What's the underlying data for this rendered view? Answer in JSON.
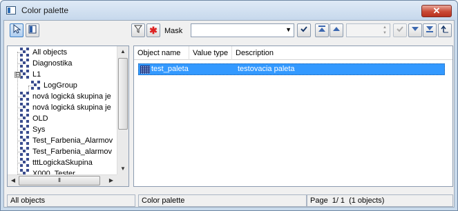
{
  "window": {
    "title": "Color palette",
    "close_label": "✕"
  },
  "toolbar": {
    "mask_label": "Mask",
    "mask_value": "",
    "spin_value": ""
  },
  "tree": {
    "items": [
      {
        "label": "All objects",
        "level": 0,
        "expander": ""
      },
      {
        "label": "Diagnostika",
        "level": 0,
        "expander": ""
      },
      {
        "label": "L1",
        "level": 0,
        "expander": "⊟"
      },
      {
        "label": "LogGroup",
        "level": 1,
        "expander": ""
      },
      {
        "label": "nová logická skupina je",
        "level": 0,
        "expander": ""
      },
      {
        "label": "nová logická skupina je",
        "level": 0,
        "expander": ""
      },
      {
        "label": "OLD",
        "level": 0,
        "expander": ""
      },
      {
        "label": "Sys",
        "level": 0,
        "expander": ""
      },
      {
        "label": "Test_Farbenia_Alarmov",
        "level": 0,
        "expander": ""
      },
      {
        "label": "Test_Farbenia_alarmov",
        "level": 0,
        "expander": ""
      },
      {
        "label": "tttLogickaSkupina",
        "level": 0,
        "expander": ""
      },
      {
        "label": "X000_Tester",
        "level": 0,
        "expander": ""
      }
    ]
  },
  "list": {
    "columns": [
      "Object name",
      "Value type",
      "Description"
    ],
    "rows": [
      {
        "name": "test_paleta",
        "value_type": "",
        "description": "testovacia paleta"
      }
    ]
  },
  "status": {
    "scope": "All objects",
    "object_type": "Color palette",
    "page_label": "Page",
    "page_value": "1/ 1",
    "count": "(1 objects)"
  }
}
